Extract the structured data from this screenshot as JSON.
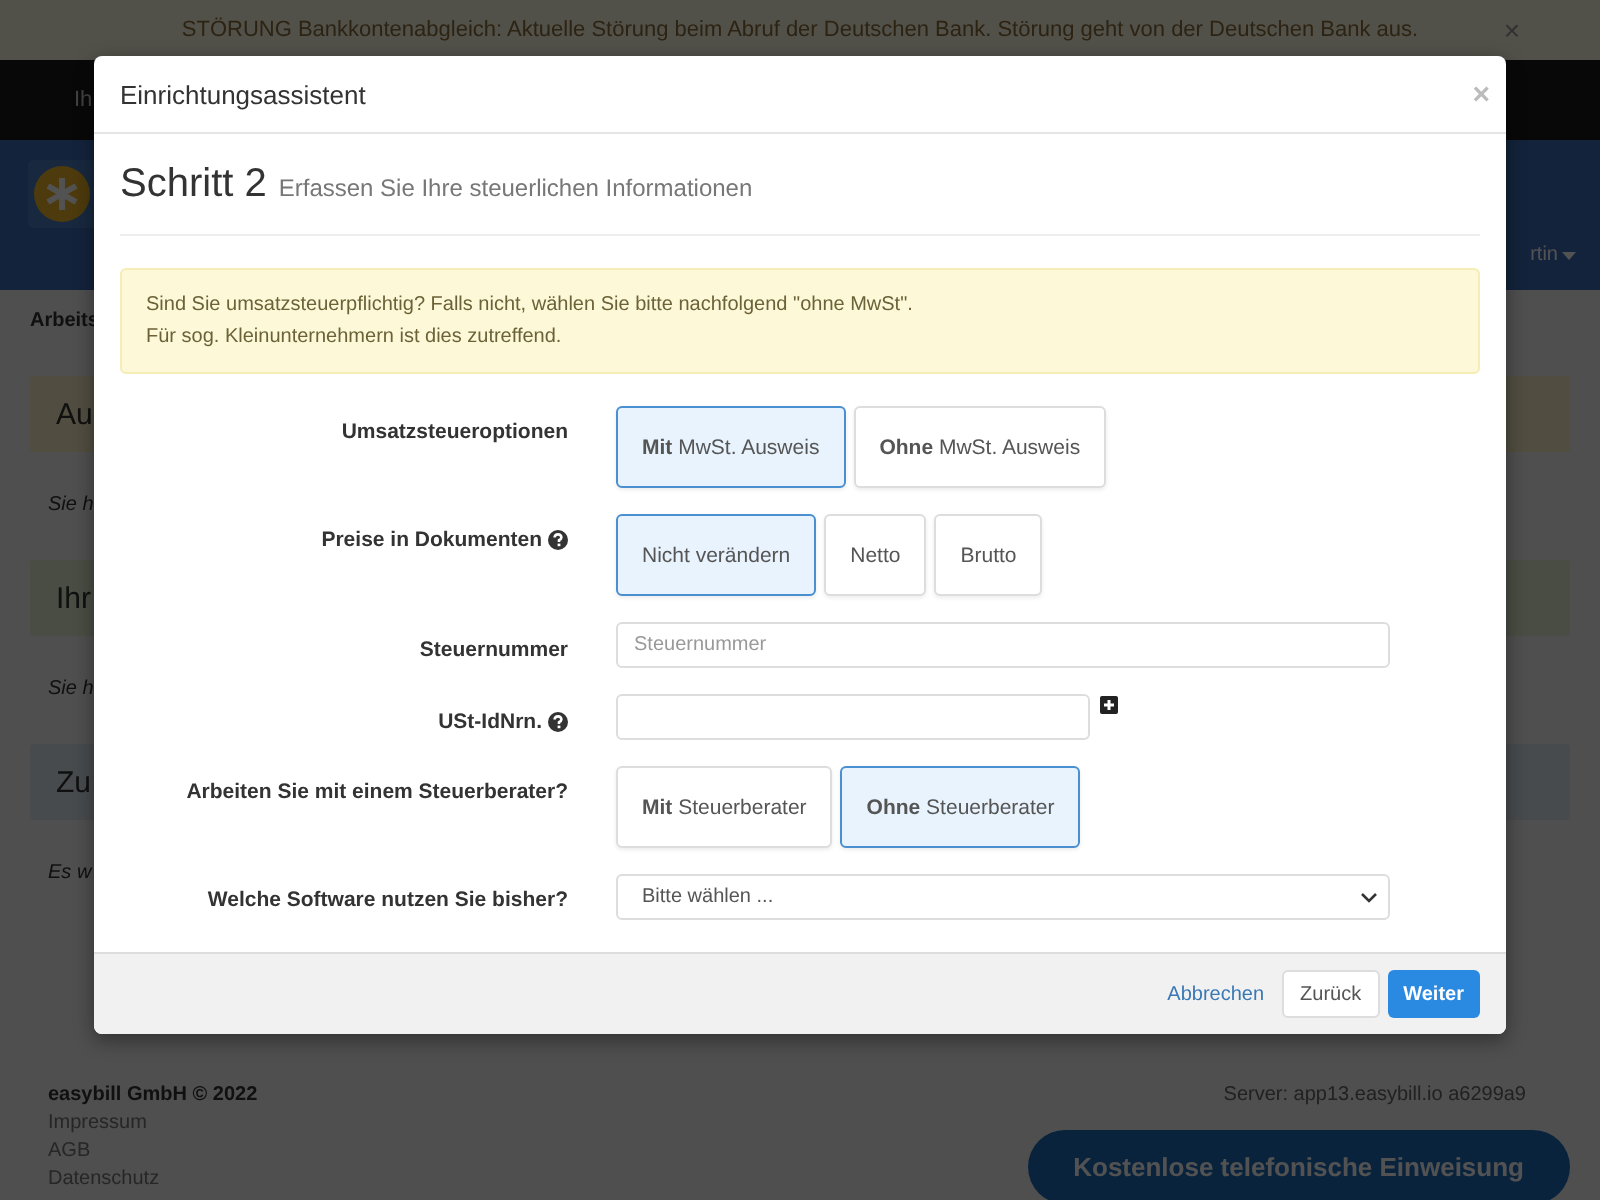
{
  "banner": {
    "text": "STÖRUNG Bankkontenabgleich: Aktuelle Störung beim Abruf der Deutschen Bank. Störung geht von der Deutschen Bank aus.",
    "close": "×"
  },
  "nav": {
    "item": "Ih"
  },
  "header": {
    "user_menu": "rtin"
  },
  "breadcrumb": "Arbeits",
  "content": [
    {
      "kind": "warning",
      "text": "Au"
    },
    {
      "kind": "text",
      "text": "Sie h"
    },
    {
      "kind": "success",
      "text": "Ihr"
    },
    {
      "kind": "text",
      "text": "Sie h"
    },
    {
      "kind": "info",
      "text": "Zu"
    },
    {
      "kind": "text",
      "text": "Es w"
    }
  ],
  "footer": {
    "company": "easybill GmbH © 2022",
    "links": [
      "Impressum",
      "AGB",
      "Datenschutz"
    ],
    "server": "Server: app13.easybill.io a6299a9",
    "call_button": "Kostenlose telefonische Einweisung"
  },
  "modal": {
    "title": "Einrichtungsassistent",
    "close": "×",
    "step": "Schritt 2",
    "subtitle": "Erfassen Sie Ihre steuerlichen Informationen",
    "alert": [
      "Sind Sie umsatzsteuerpflichtig? Falls nicht, wählen Sie bitte nachfolgend \"ohne MwSt\".",
      "Für sog. Kleinunternehmern ist dies zutreffend."
    ],
    "rows": [
      {
        "kind": "choice",
        "label": "Umsatzsteueroptionen",
        "help": false,
        "options": [
          {
            "text": "**Mit** MwSt. Ausweis",
            "selected": true
          },
          {
            "text": "**Ohne** MwSt. Ausweis",
            "selected": false
          }
        ]
      },
      {
        "kind": "choice",
        "label": "Preise in Dokumenten",
        "help": true,
        "options": [
          {
            "text": "Nicht verändern",
            "selected": true
          },
          {
            "text": "Netto",
            "selected": false
          },
          {
            "text": "Brutto",
            "selected": false
          }
        ]
      },
      {
        "kind": "input",
        "label": "Steuernummer",
        "help": false,
        "placeholder": "Steuernummer",
        "wide": true,
        "add": false
      },
      {
        "kind": "input",
        "label": "USt-IdNrn.",
        "help": true,
        "wide": false,
        "add": true
      },
      {
        "kind": "choice",
        "label": "Arbeiten Sie mit einem Steuerberater?",
        "help": false,
        "options": [
          {
            "text": "**Mit** Steuerberater",
            "selected": false
          },
          {
            "text": "**Ohne** Steuerberater",
            "selected": true
          }
        ]
      },
      {
        "kind": "select",
        "label": "Welche Software nutzen Sie bisher?",
        "help": false,
        "value": "Bitte wählen ..."
      }
    ],
    "buttons": {
      "cancel": "Abbrechen",
      "back": "Zurück",
      "next": "Weiter"
    }
  }
}
